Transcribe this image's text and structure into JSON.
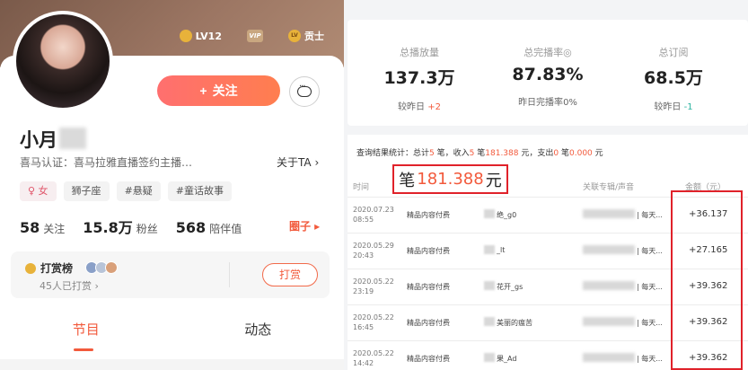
{
  "profile": {
    "level_badge": "LV12",
    "vip_badge": "VIP",
    "fan_badge": "LV",
    "fan_title": "贡士",
    "follow_label": "关注",
    "name": "小月",
    "certification": "喜马认证：喜马拉雅直播签约主播…",
    "about_label": "关于TA",
    "tags": [
      "♀ 女",
      "狮子座",
      "#悬疑",
      "#童话故事"
    ],
    "stats": [
      {
        "value": "58",
        "label": "关注"
      },
      {
        "value": "15.8万",
        "label": "粉丝"
      },
      {
        "value": "568",
        "label": "陪伴值"
      }
    ],
    "circle_label": "圈子 ▸",
    "reward": {
      "title": "打赏榜",
      "subtitle": "45人已打赏",
      "button": "打赏"
    },
    "tabs": [
      "节目",
      "动态"
    ],
    "active_tab": 0
  },
  "summary": {
    "metrics": [
      {
        "label": "总播放量",
        "value": "137.3万",
        "sub_prefix": "较昨日",
        "sub_value": "+2",
        "sub_kind": "up"
      },
      {
        "label": "总完播率◎",
        "value": "87.83%",
        "sub_prefix": "昨日完播率",
        "sub_value": "0%",
        "sub_kind": "plain"
      },
      {
        "label": "总订阅",
        "value": "68.5万",
        "sub_prefix": "较昨日",
        "sub_value": "-1",
        "sub_kind": "down"
      }
    ]
  },
  "query": {
    "prefix": "查询结果统计：总计",
    "total_count": "5",
    "unit1": "笔，收入",
    "income_count": "5",
    "unit2": "笔",
    "income_amount": "181.388",
    "unit3": "元，支出",
    "expense_count": "0",
    "unit4": "笔",
    "expense_amount": "0.000",
    "unit5": "元"
  },
  "highlight": {
    "prefix": "笔",
    "amount": "181.388",
    "unit": "元"
  },
  "table": {
    "headers": {
      "time": "时间",
      "album": "关联专辑/声音",
      "amount": "金额（元）"
    },
    "rows": [
      {
        "date": "2020.07.23",
        "clock": "08:55",
        "type": "精品内容付费",
        "track": "绝_g0",
        "album": "| 每天...",
        "amount": "+36.137"
      },
      {
        "date": "2020.05.29",
        "clock": "20:43",
        "type": "精品内容付费",
        "track": "_lt",
        "album": "| 每天...",
        "amount": "+27.165"
      },
      {
        "date": "2020.05.22",
        "clock": "23:19",
        "type": "精品内容付费",
        "track": "花开_gs",
        "album": "| 每天...",
        "amount": "+39.362"
      },
      {
        "date": "2020.05.22",
        "clock": "16:45",
        "type": "精品内容付费",
        "track": "美丽的瘟苦",
        "album": "| 每天...",
        "amount": "+39.362"
      },
      {
        "date": "2020.05.22",
        "clock": "14:42",
        "type": "精品内容付费",
        "track": "果_Ad",
        "album": "| 每天...",
        "amount": "+39.362"
      }
    ]
  },
  "colors": {
    "accent": "#f25a3c",
    "highlight_border": "#e0222a",
    "down": "#2bb3a0"
  }
}
